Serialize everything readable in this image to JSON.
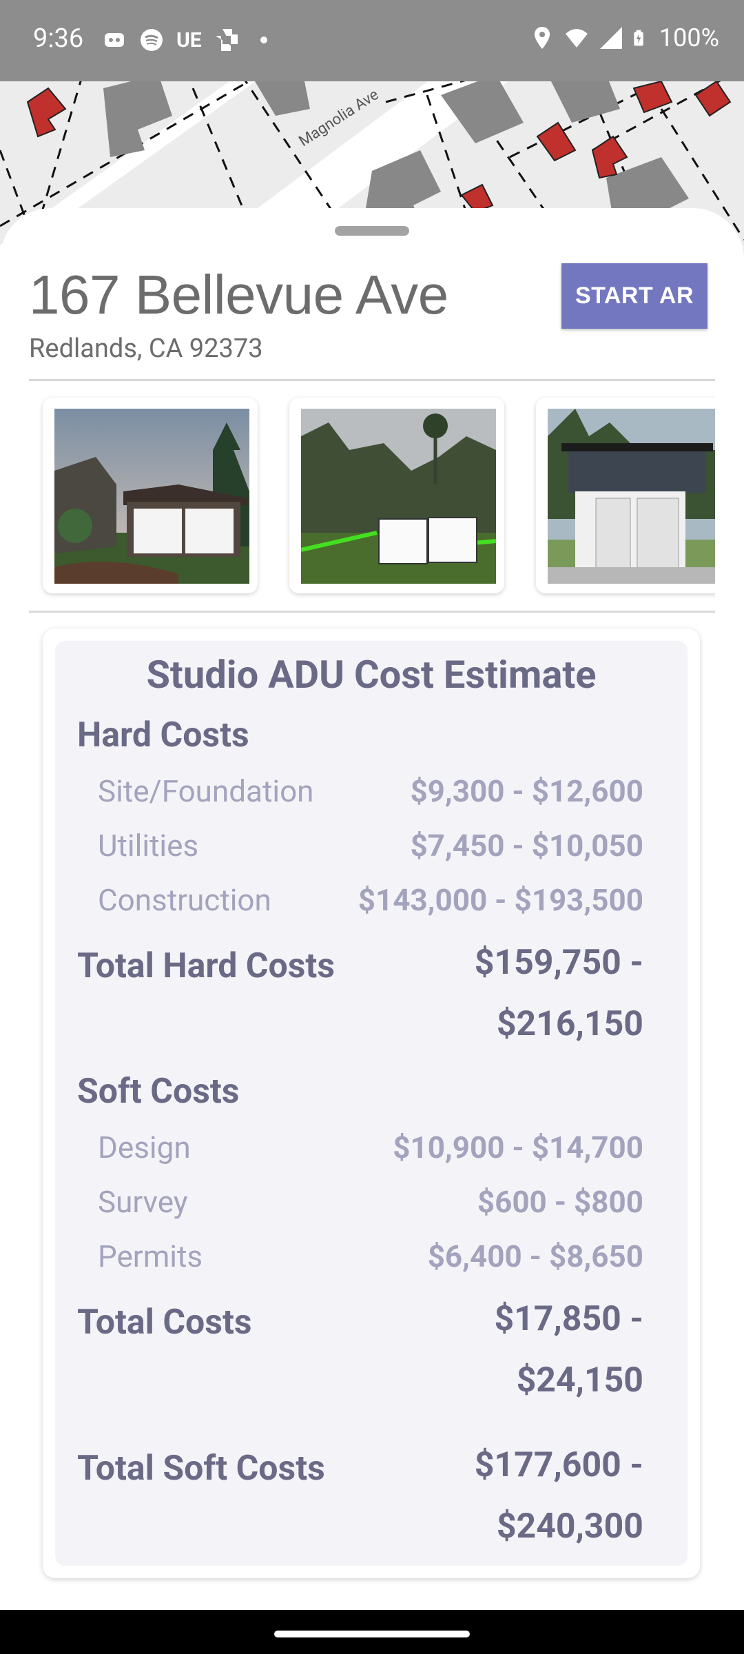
{
  "status_bar": {
    "time": "9:36",
    "left_icons": [
      "ai-assistant-icon",
      "spotify-icon",
      "ue-text-icon",
      "chase-icon",
      "dot-icon"
    ],
    "ue_text": "UE",
    "battery": "100%",
    "right_icons": [
      "location-icon",
      "wifi-icon",
      "signal-icon",
      "battery-charging-icon"
    ]
  },
  "map": {
    "street_label": "Magnolia Ave"
  },
  "property": {
    "address": "167 Bellevue Ave",
    "city": "Redlands, CA 92373",
    "start_ar_label": "START AR"
  },
  "gallery": {
    "images": [
      "garage-style-adu-render",
      "backyard-ar-placement",
      "modern-studio-adu-render"
    ]
  },
  "estimate": {
    "title": "Studio ADU Cost Estimate",
    "hard_costs": {
      "heading": "Hard Costs",
      "items": [
        {
          "label": "Site/Foundation",
          "value": "$9,300 - $12,600"
        },
        {
          "label": "Utilities",
          "value": "$7,450 - $10,050"
        },
        {
          "label": "Construction",
          "value": "$143,000 - $193,500"
        }
      ],
      "total_label": "Total Hard Costs",
      "total_value_line1": "$159,750 -",
      "total_value_line2": "$216,150"
    },
    "soft_costs": {
      "heading": "Soft Costs",
      "items": [
        {
          "label": "Design",
          "value": "$10,900 - $14,700"
        },
        {
          "label": "Survey",
          "value": "$600 - $800"
        },
        {
          "label": "Permits",
          "value": "$6,400 - $8,650"
        }
      ],
      "total_label": "Total Costs",
      "total_value_line1": "$17,850 -",
      "total_value_line2": "$24,150"
    },
    "grand_total": {
      "label": "Total Soft Costs",
      "value_line1": "$177,600 -",
      "value_line2": "$240,300"
    }
  },
  "colors": {
    "accent_button": "#7377c0",
    "heading_text": "#6a6a86",
    "muted_text": "#a3a3bd",
    "status_bar": "#8d8d8d"
  }
}
